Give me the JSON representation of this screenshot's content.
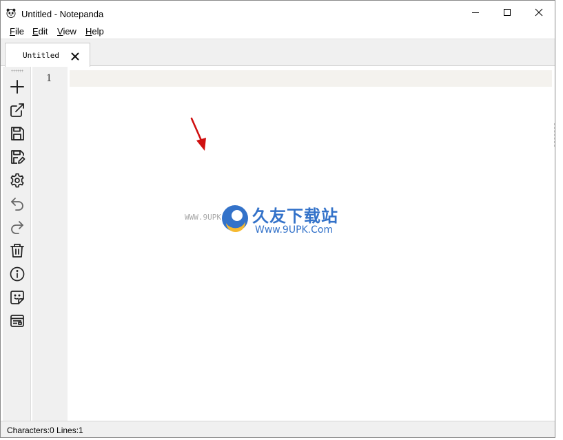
{
  "window": {
    "title": "Untitled - Notepanda",
    "controls": [
      "minimize-icon",
      "maximize-icon",
      "close-icon"
    ]
  },
  "menu": {
    "file": {
      "mnemonic": "F",
      "rest": "ile"
    },
    "edit": {
      "mnemonic": "E",
      "rest": "dit"
    },
    "view": {
      "mnemonic": "V",
      "rest": "iew"
    },
    "help": {
      "mnemonic": "H",
      "rest": "elp"
    }
  },
  "tabs": [
    {
      "label": "Untitled",
      "close_glyph": "✕",
      "active": true
    }
  ],
  "toolbar": {
    "icons": [
      "new-icon",
      "open-icon",
      "save-icon",
      "save-as-icon",
      "settings-icon",
      "undo-icon",
      "redo-icon",
      "trash-icon",
      "info-icon",
      "sticky-note-icon",
      "layout-icon"
    ]
  },
  "editor": {
    "line_numbers": [
      "1"
    ],
    "content": ""
  },
  "status": {
    "text": "Characters:0 Lines:1"
  },
  "watermark": {
    "url": "WWW.9UPK.COM",
    "chinese": "久友下载站",
    "english": "Www.9UPK.Com"
  },
  "colors": {
    "accent": "#1d63c4",
    "arrow": "#d01010",
    "current_line": "#f4f2ee",
    "panel": "#f0f0f0"
  }
}
